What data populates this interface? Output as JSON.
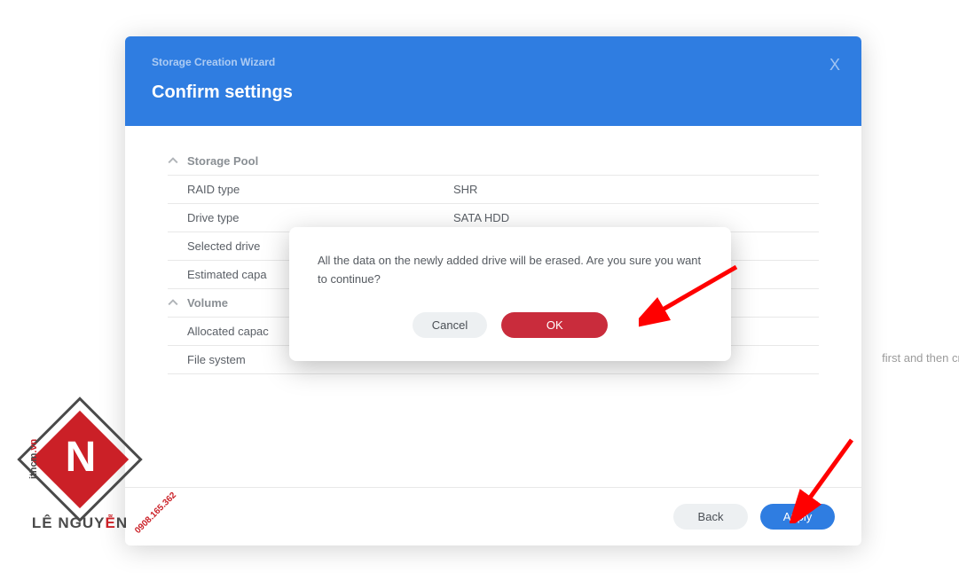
{
  "bg_text": "first and then cre",
  "wizard": {
    "title_small": "Storage Creation Wizard",
    "title_big": "Confirm settings",
    "close_glyph": "X",
    "sections": {
      "pool": {
        "label": "Storage Pool",
        "rows": [
          {
            "key": "RAID type",
            "val": "SHR"
          },
          {
            "key": "Drive type",
            "val": "SATA HDD"
          },
          {
            "key": "Selected drive",
            "val": ""
          },
          {
            "key": "Estimated capa",
            "val": ""
          }
        ]
      },
      "volume": {
        "label": "Volume",
        "rows": [
          {
            "key": "Allocated capac",
            "val": ""
          },
          {
            "key": "File system",
            "val": ""
          }
        ]
      }
    },
    "footer": {
      "back": "Back",
      "apply": "Apply"
    }
  },
  "modal": {
    "message": "All the data on the newly added drive will be erased. Are you sure you want to continue?",
    "cancel": "Cancel",
    "ok": "OK"
  },
  "logo": {
    "letter": "N",
    "brand": "LÊ NGUY",
    "brand_accent": "Ễ",
    "brand_tail": "N",
    "side1": "ithcm",
    "side1b": ".vn",
    "phone": "0908.165.362"
  }
}
